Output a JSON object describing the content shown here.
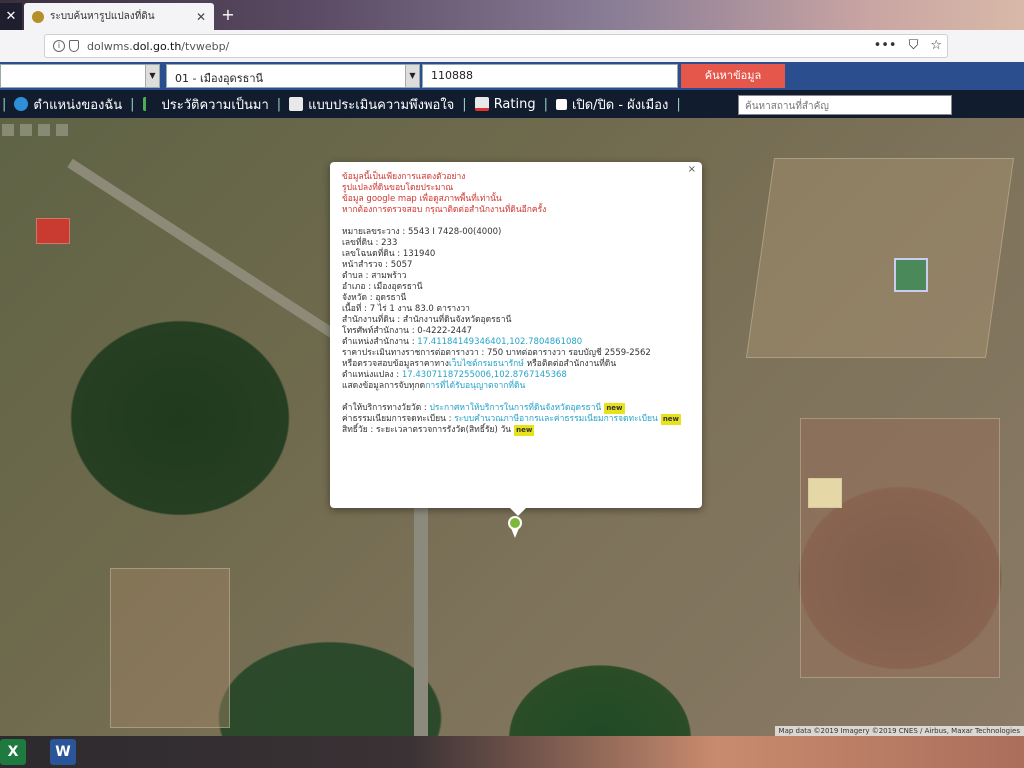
{
  "browser": {
    "tab_title": "ระบบค้นหารูปแปลงที่ดิน",
    "tab_close_left": "✕",
    "tab_close": "✕",
    "new_tab": "+",
    "url_prefix": "dolwms.",
    "url_domain": "dol.go.th",
    "url_suffix": "/tvwebp/",
    "url_actions": [
      "•••",
      "⛉",
      "☆"
    ]
  },
  "search": {
    "district": "01 - เมืองอุดรธานี",
    "parcel_no": "110888",
    "button": "ค้นหาข้อมูล"
  },
  "menu": {
    "items": [
      {
        "label": "ตำแหน่งของฉัน",
        "icon": "location-icon"
      },
      {
        "label": "ประวัติความเป็นมา",
        "icon": "history-icon"
      },
      {
        "label": "แบบประเมินความพึงพอใจ",
        "icon": "survey-icon"
      },
      {
        "label": "Rating",
        "icon": "chart-icon"
      },
      {
        "label": "เปิด/ปิด - ผังเมือง",
        "icon": "checkbox-icon"
      }
    ],
    "place_search_placeholder": "ค้นหาสถานที่สำคัญ"
  },
  "popup": {
    "close": "×",
    "warning_lines": [
      "ข้อมูลนี้เป็นเพียงการแสดงตัวอย่าง",
      "รูปแปลงที่ดินขอบโดยประมาณ",
      "ข้อมูล google map เพื่อดูสภาพพื้นที่เท่านั้น",
      "หากต้องการตรวจสอบ กรุณาติดต่อสำนักงานที่ดินอีกครั้ง"
    ],
    "fields": [
      {
        "label": "หมายเลขระวาง",
        "value": "5543 I 7428-00(4000)"
      },
      {
        "label": "เลขที่ดิน",
        "value": "233"
      },
      {
        "label": "เลขโฉนดที่ดิน",
        "value": "131940"
      },
      {
        "label": "หน้าสำรวจ",
        "value": "5057"
      },
      {
        "label": "ตำบล",
        "value": "สามพร้าว"
      },
      {
        "label": "อำเภอ",
        "value": "เมืองอุดรธานี"
      },
      {
        "label": "จังหวัด",
        "value": "อุดรธานี"
      },
      {
        "label": "เนื้อที่",
        "value": "7 ไร่ 1 งาน 83.0 ตารางวา"
      },
      {
        "label": "สำนักงานที่ดิน",
        "value": "สำนักงานที่ดินจังหวัดอุดรธานี"
      },
      {
        "label": "โทรศัพท์สำนักงาน",
        "value": "0-4222-2447"
      }
    ],
    "office_location_label": "ตำแหน่งสำนักงาน",
    "office_location_value": "17.41184149346401,102.7804861080",
    "price_line": "ราคาประเมินทางราชการต่อตารางวา : 750 บาทต่อตารางวา รอบบัญชี 2559-2562",
    "price_check_label": "หรือตรวจสอบข้อมูลราคาทาง",
    "price_check_link": "เว็บไซต์กรมธนารักษ์",
    "price_check_suffix": "หรือติดต่อสำนักงานที่ดิน",
    "parcel_location_label": "ตำแหน่งแปลง",
    "parcel_location_value": "17.43071187255006,102.8767145368",
    "parcel_list_label": "แสดงข้อมูลการจับทุกด",
    "parcel_list_link": "การที่ได้รับอนุญาตจากที่ดิน",
    "service_rows": [
      {
        "label": "คำให้บริการทางวัยวัด",
        "link": "ประกาศหาให้บริการในการที่ดินจังหวัดอุดรธานี",
        "badge": "new"
      },
      {
        "label": "ค่าธรรมเนียมการจดทะเบียน",
        "link": "ระบบคำนวณภาษีอากรและค่าธรรมเนียมการจดทะเบียน",
        "badge": "new"
      },
      {
        "label": "สิทธิ์วัย : ระยะเวลาตรวจการรังวัด(สิทธิ์รัย) วัน",
        "link": "",
        "badge": "new"
      }
    ]
  },
  "map": {
    "attribution": "Map data ©2019 Imagery ©2019 CNES / Airbus, Maxar Technologies"
  },
  "taskbar": {
    "apps": [
      {
        "name": "excel",
        "label": "X",
        "color": "#1f7a3f"
      },
      {
        "name": "word",
        "label": "W",
        "color": "#2a5699"
      }
    ]
  }
}
